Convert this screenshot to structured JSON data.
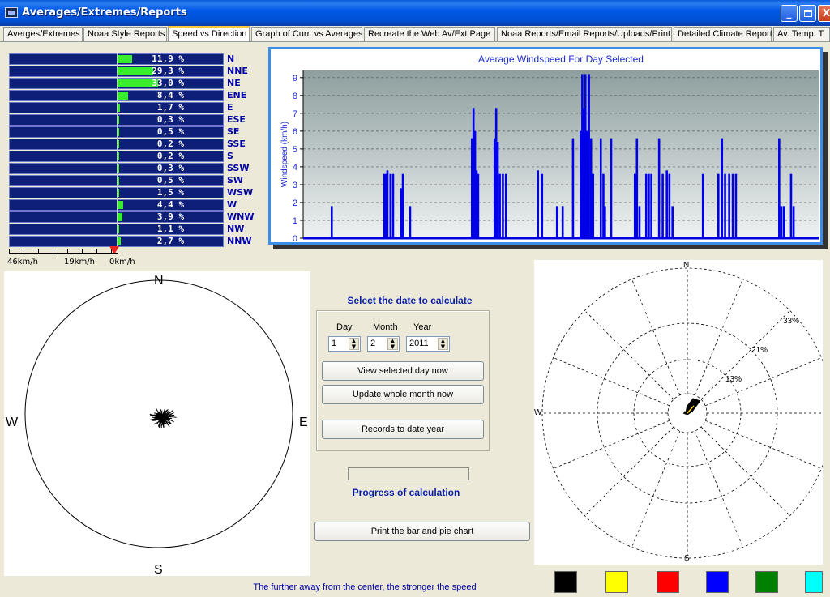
{
  "window": {
    "title": "Averages/Extremes/Reports",
    "min_label": "_",
    "close_label": "X"
  },
  "tabs": [
    {
      "label": "Averges/Extremes"
    },
    {
      "label": "Noaa Style Reports"
    },
    {
      "label": "Speed vs Direction"
    },
    {
      "label": "Graph of Curr. vs Averages"
    },
    {
      "label": "Recreate the Web Av/Ext Page"
    },
    {
      "label": "Noaa Reports/Email Reports/Uploads/Print"
    },
    {
      "label": "Detailed Climate Report"
    },
    {
      "label": "Av. Temp. T"
    }
  ],
  "direction_bars": {
    "rows": [
      {
        "dir": "N",
        "pct_label": "11,9 %",
        "value": 11.9
      },
      {
        "dir": "NNE",
        "pct_label": "29,3 %",
        "value": 29.3
      },
      {
        "dir": "NE",
        "pct_label": "33,0 %",
        "value": 33.0
      },
      {
        "dir": "ENE",
        "pct_label": "8,4 %",
        "value": 8.4
      },
      {
        "dir": "E",
        "pct_label": "1,7 %",
        "value": 1.7
      },
      {
        "dir": "ESE",
        "pct_label": "0,3 %",
        "value": 0.3
      },
      {
        "dir": "SE",
        "pct_label": "0,5 %",
        "value": 0.5
      },
      {
        "dir": "SSE",
        "pct_label": "0,2 %",
        "value": 0.2
      },
      {
        "dir": "S",
        "pct_label": "0,2 %",
        "value": 0.2
      },
      {
        "dir": "SSW",
        "pct_label": "0,3 %",
        "value": 0.3
      },
      {
        "dir": "SW",
        "pct_label": "0,5 %",
        "value": 0.5
      },
      {
        "dir": "WSW",
        "pct_label": "1,5 %",
        "value": 1.5
      },
      {
        "dir": "W",
        "pct_label": "4,4 %",
        "value": 4.4
      },
      {
        "dir": "WNW",
        "pct_label": "3,9 %",
        "value": 3.9
      },
      {
        "dir": "NW",
        "pct_label": "1,1 %",
        "value": 1.1
      },
      {
        "dir": "NNW",
        "pct_label": "2,7 %",
        "value": 2.7
      }
    ],
    "scale_labels": [
      "46km/h",
      "19km/h",
      "0km/h"
    ]
  },
  "chart_data": {
    "type": "area",
    "title": "Average Windspeed For Day Selected",
    "ylabel": "Windspeed (km/h)",
    "xlabel": "",
    "ylim": [
      0,
      9.4
    ],
    "yticks": [
      0,
      1,
      2,
      3,
      4,
      5,
      6,
      7,
      8,
      9
    ],
    "grid": true,
    "x_range": [
      0,
      1000
    ],
    "spikes": [
      {
        "x": 55,
        "y": 1.8
      },
      {
        "x": 157,
        "y": 3.6
      },
      {
        "x": 160,
        "y": 3.6
      },
      {
        "x": 163,
        "y": 3.8
      },
      {
        "x": 169,
        "y": 3.6
      },
      {
        "x": 174,
        "y": 3.6
      },
      {
        "x": 190,
        "y": 2.8
      },
      {
        "x": 193,
        "y": 3.6
      },
      {
        "x": 207,
        "y": 1.8
      },
      {
        "x": 327,
        "y": 5.6
      },
      {
        "x": 330,
        "y": 7.3
      },
      {
        "x": 333,
        "y": 6.0
      },
      {
        "x": 336,
        "y": 3.8
      },
      {
        "x": 339,
        "y": 3.6
      },
      {
        "x": 371,
        "y": 5.6
      },
      {
        "x": 374,
        "y": 7.3
      },
      {
        "x": 377,
        "y": 5.4
      },
      {
        "x": 381,
        "y": 3.6
      },
      {
        "x": 387,
        "y": 3.6
      },
      {
        "x": 393,
        "y": 3.6
      },
      {
        "x": 455,
        "y": 3.8
      },
      {
        "x": 463,
        "y": 3.6
      },
      {
        "x": 492,
        "y": 1.8
      },
      {
        "x": 503,
        "y": 1.8
      },
      {
        "x": 523,
        "y": 5.6
      },
      {
        "x": 538,
        "y": 6.0
      },
      {
        "x": 541,
        "y": 9.2
      },
      {
        "x": 544,
        "y": 7.3
      },
      {
        "x": 547,
        "y": 9.2
      },
      {
        "x": 550,
        "y": 6.0
      },
      {
        "x": 554,
        "y": 9.2
      },
      {
        "x": 558,
        "y": 5.6
      },
      {
        "x": 562,
        "y": 3.6
      },
      {
        "x": 577,
        "y": 5.6
      },
      {
        "x": 582,
        "y": 3.6
      },
      {
        "x": 585,
        "y": 1.8
      },
      {
        "x": 597,
        "y": 5.6
      },
      {
        "x": 643,
        "y": 3.6
      },
      {
        "x": 647,
        "y": 5.6
      },
      {
        "x": 652,
        "y": 1.8
      },
      {
        "x": 665,
        "y": 3.6
      },
      {
        "x": 670,
        "y": 3.6
      },
      {
        "x": 675,
        "y": 3.6
      },
      {
        "x": 690,
        "y": 5.6
      },
      {
        "x": 697,
        "y": 3.6
      },
      {
        "x": 705,
        "y": 3.8
      },
      {
        "x": 710,
        "y": 3.6
      },
      {
        "x": 716,
        "y": 1.8
      },
      {
        "x": 775,
        "y": 3.6
      },
      {
        "x": 805,
        "y": 3.6
      },
      {
        "x": 812,
        "y": 5.6
      },
      {
        "x": 818,
        "y": 3.6
      },
      {
        "x": 826,
        "y": 3.6
      },
      {
        "x": 833,
        "y": 3.6
      },
      {
        "x": 839,
        "y": 3.6
      },
      {
        "x": 923,
        "y": 5.6
      },
      {
        "x": 927,
        "y": 1.8
      },
      {
        "x": 932,
        "y": 1.8
      },
      {
        "x": 946,
        "y": 3.6
      },
      {
        "x": 951,
        "y": 1.8
      }
    ],
    "series": [
      {
        "values_are": "spikes"
      }
    ]
  },
  "left_compass": {
    "n": "N",
    "s": "S",
    "e": "E",
    "w": "W"
  },
  "date_select": {
    "title": "Select the date to calculate",
    "day_label": "Day",
    "month_label": "Month",
    "year_label": "Year",
    "day": "1",
    "month": "2",
    "year": "2011",
    "spin_up": "▲",
    "spin_down": "▼",
    "btn_view_day": "View selected day now",
    "btn_update_month": "Update whole month now",
    "btn_records_year": "Records to date year",
    "progress_label": "Progress of calculation",
    "progress": 0,
    "btn_print": "Print the bar and pie chart"
  },
  "footer": {
    "note": "The further away from the center, the stronger the speed"
  },
  "polar": {
    "n": "N",
    "s": "S",
    "w": "W",
    "ring_labels": [
      "13%",
      "21%",
      "33%"
    ]
  },
  "swatches": [
    "#000000",
    "#ffff00",
    "#ff0000",
    "#0000ff",
    "#008000",
    "#00ffff"
  ]
}
